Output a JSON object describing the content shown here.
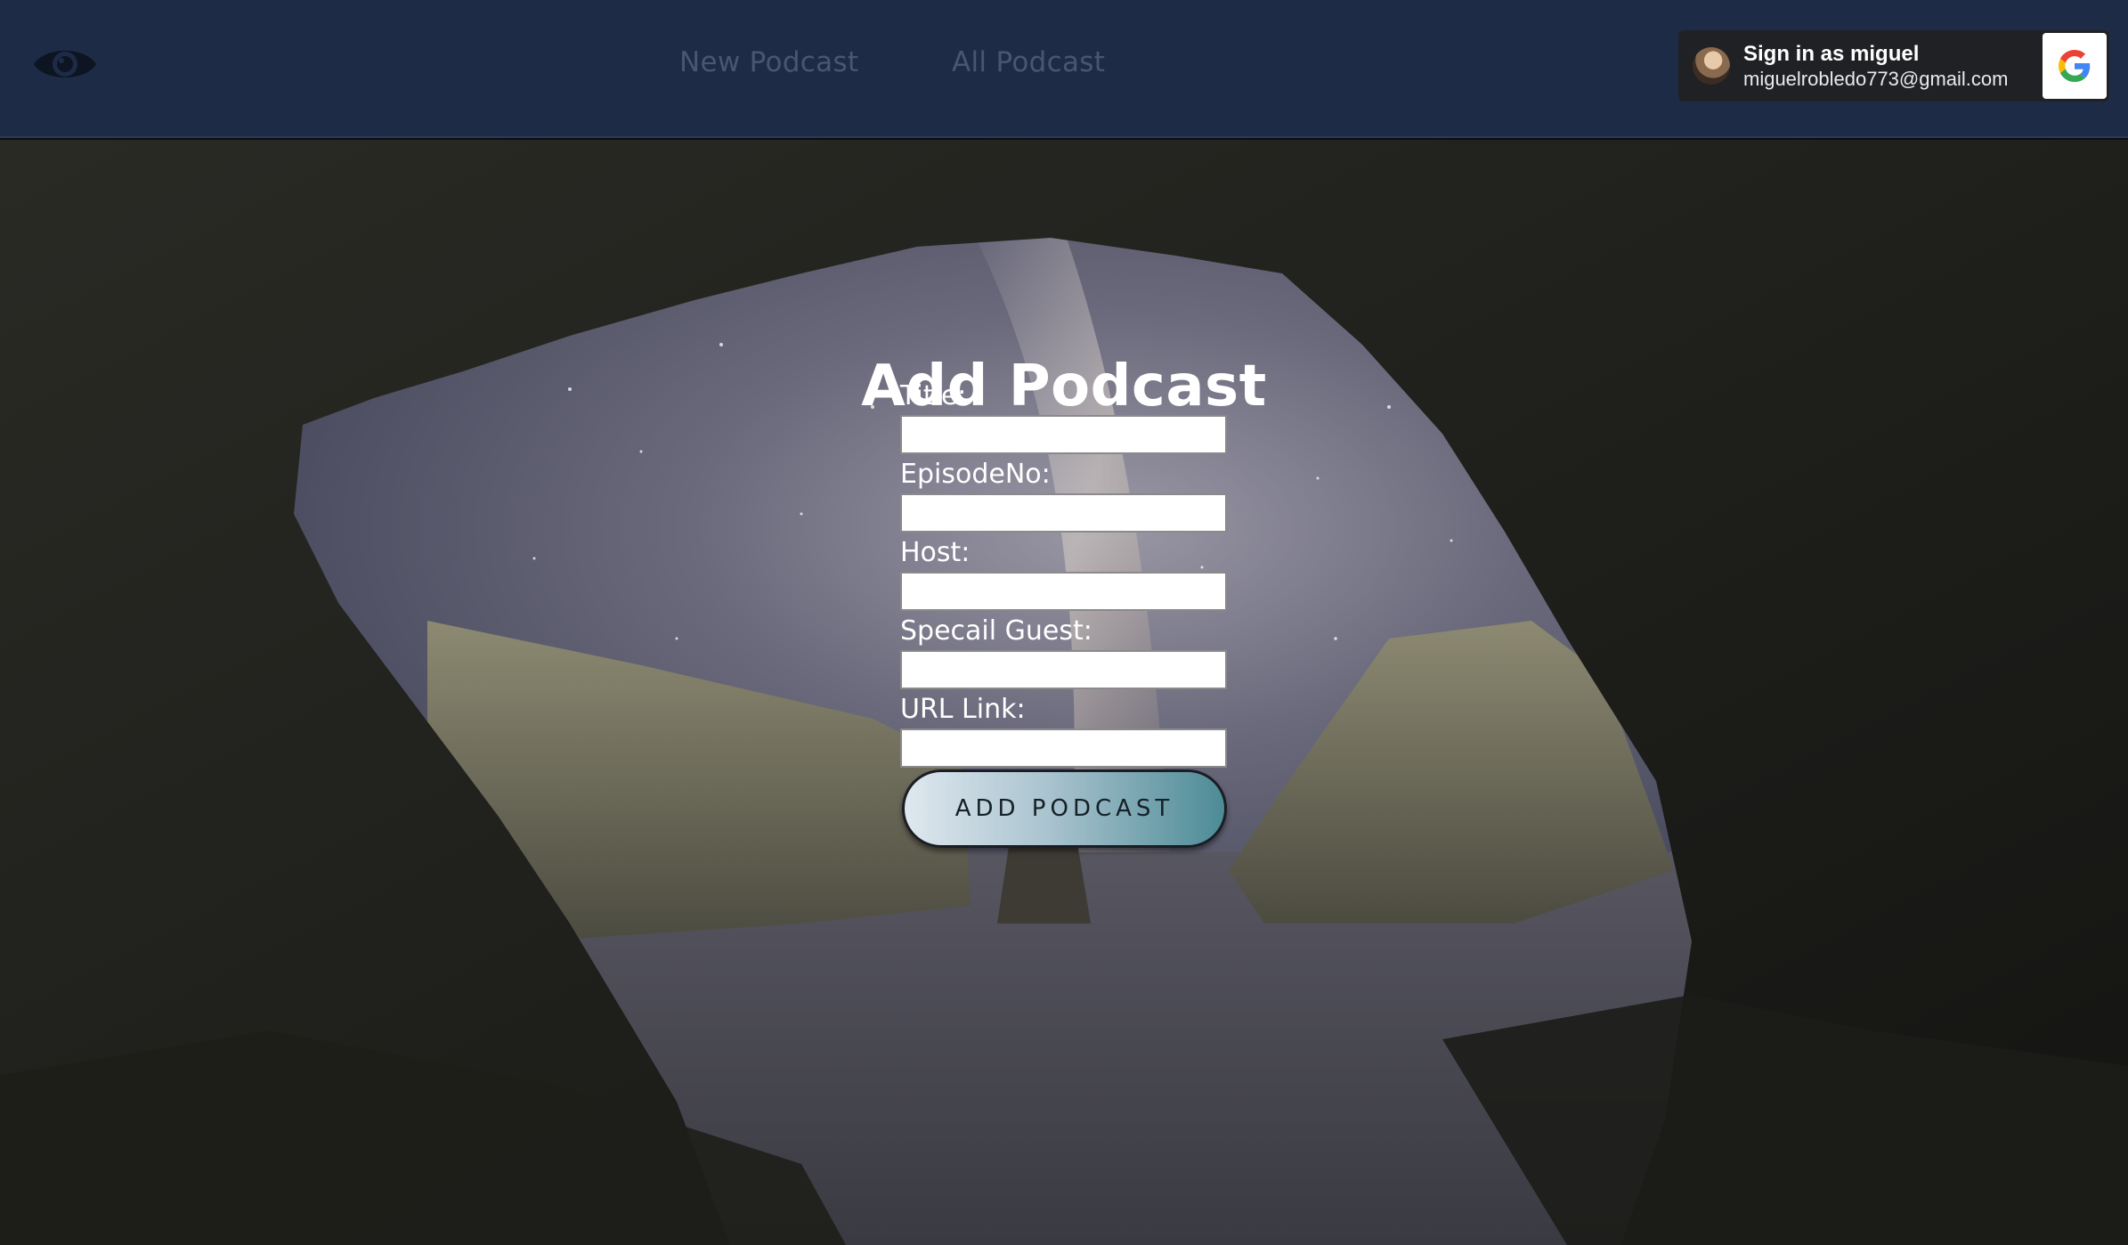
{
  "nav": {
    "logo_icon": "eye-icon",
    "links": [
      "New Podcast",
      "All Podcast"
    ]
  },
  "signin": {
    "name": "Sign in as miguel",
    "email": "miguelrobledo773@gmail.com",
    "provider_icon": "google-icon"
  },
  "main": {
    "title": "Add Podcast",
    "fields": [
      {
        "label": "Title:",
        "value": ""
      },
      {
        "label": "EpisodeNo:",
        "value": ""
      },
      {
        "label": "Host:",
        "value": ""
      },
      {
        "label": "Specail Guest:",
        "value": ""
      },
      {
        "label": "URL Link:",
        "value": ""
      }
    ],
    "submit_label": "ADD PODCAST"
  },
  "colors": {
    "navbar": "#1e2b47",
    "nav_link": "#4a5670",
    "signin_bg": "#202124",
    "button_gradient_end": "#4d8b96"
  }
}
